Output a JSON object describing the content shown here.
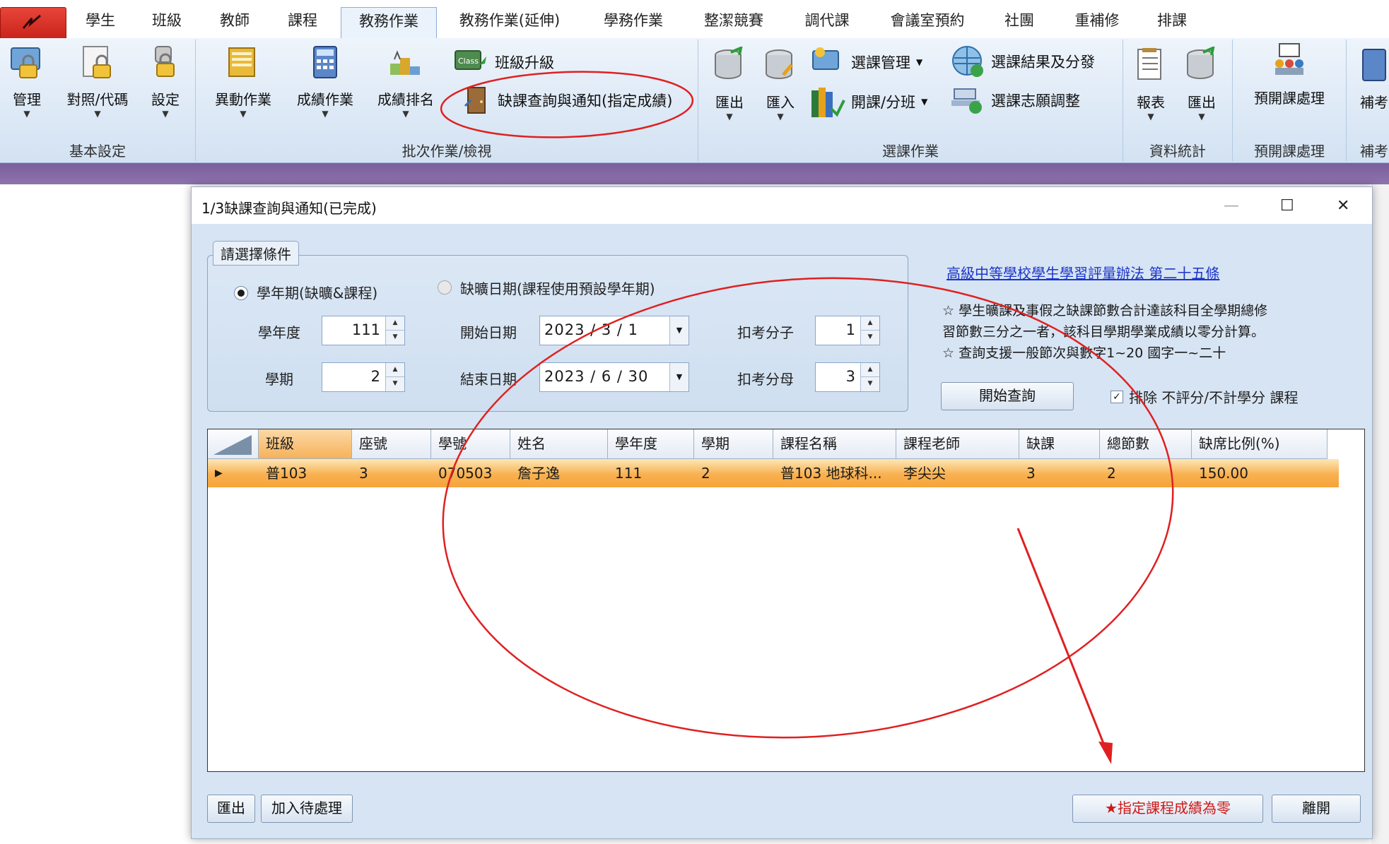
{
  "tabs": [
    "學生",
    "班級",
    "教師",
    "課程",
    "教務作業",
    "教務作業(延伸)",
    "學務作業",
    "整潔競賽",
    "調代課",
    "會議室預約",
    "社團",
    "重補修",
    "排課"
  ],
  "ribbon": {
    "basic": {
      "items": [
        "管理",
        "對照/代碼",
        "設定"
      ],
      "label": "基本設定"
    },
    "batch": {
      "items": [
        "異動作業",
        "成績作業",
        "成績排名"
      ],
      "class_upgrade": "班級升級",
      "absence_query": "缺課查詢與通知(指定成績)",
      "label": "批次作業/檢視"
    },
    "course": {
      "export": "匯出",
      "import": "匯入",
      "course_manage": "選課管理",
      "open_class": "開課/分班",
      "result_dist": "選課結果及分發",
      "wish_adjust": "選課志願調整",
      "label": "選課作業"
    },
    "stats": {
      "report": "報表",
      "export": "匯出",
      "label": "資料統計"
    },
    "preopen": {
      "item": "預開課處理",
      "label": "預開課處理"
    },
    "makeup": {
      "item": "補考",
      "label": "補考"
    }
  },
  "dialog": {
    "title": "1/3缺課查詢與通知(已完成)",
    "legend": "請選擇條件",
    "radio_term": "學年期(缺曠&課程)",
    "radio_date": "缺曠日期(課程使用預設學年期)",
    "year_label": "學年度",
    "year_value": "111",
    "sem_label": "學期",
    "sem_value": "2",
    "start_label": "開始日期",
    "start_value": "2023 / 3 / 1",
    "end_label": "結束日期",
    "end_value": "2023 / 6 / 30",
    "num_label": "扣考分子",
    "num_value": "1",
    "den_label": "扣考分母",
    "den_value": "3",
    "law_link": "高級中等學校學生學習評量辦法 第二十五條",
    "note1": "☆ 學生曠課及事假之缺課節數合計達該科目全學期總修",
    "note2": "習節數三分之一者，該科目學期學業成績以零分計算。",
    "note3": "☆ 查詢支援一般節次與數字1~20 國字一~二十",
    "query_btn": "開始查詢",
    "exclude_label": "排除 不評分/不計學分 課程",
    "columns": [
      "班級",
      "座號",
      "學號",
      "姓名",
      "學年度",
      "學期",
      "課程名稱",
      "課程老師",
      "缺課",
      "總節數",
      "缺席比例(%)"
    ],
    "rows": [
      [
        "普103",
        "3",
        "070503",
        "詹子逸",
        "111",
        "2",
        "普103 地球科...",
        "李尖尖",
        "3",
        "2",
        "150.00"
      ]
    ],
    "export_btn": "匯出",
    "add_pending_btn": "加入待處理",
    "zero_btn": "★指定課程成績為零",
    "leave_btn": "離開"
  },
  "colors": {
    "annotation": "#e02020",
    "band": "#7a5f9c",
    "selection": "#f6a43a"
  }
}
